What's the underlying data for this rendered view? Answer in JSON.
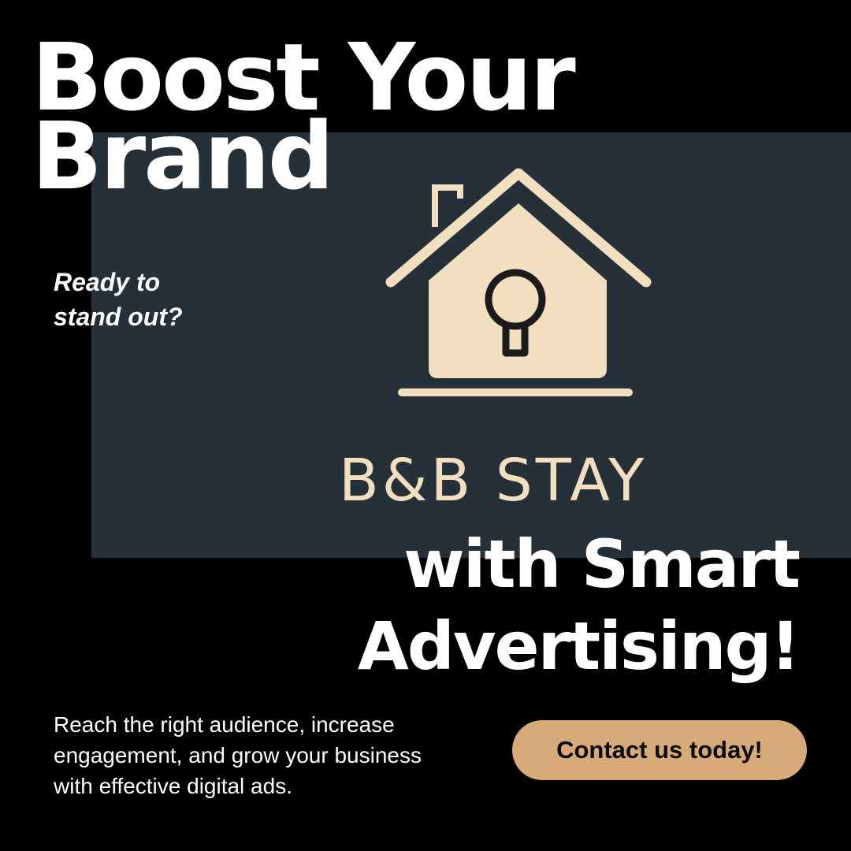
{
  "headline": {
    "line1": "Boost Your",
    "line2": "Brand"
  },
  "tagline": {
    "line1": "Ready to",
    "line2": "stand out?"
  },
  "logo": {
    "icon": "house-keyhole-icon",
    "brand_name": "B&B STAY",
    "color": "#f1dfbf"
  },
  "subhead": {
    "line1": "with Smart",
    "line2": "Advertising!"
  },
  "description": {
    "line1": "Reach the right audience, increase",
    "line2": "engagement, and grow your business",
    "line3": "with effective digital ads."
  },
  "cta": {
    "label": "Contact us today!",
    "color": "#d9aa79"
  },
  "colors": {
    "background": "#000000",
    "panel": "#263038",
    "text": "#ffffff"
  }
}
